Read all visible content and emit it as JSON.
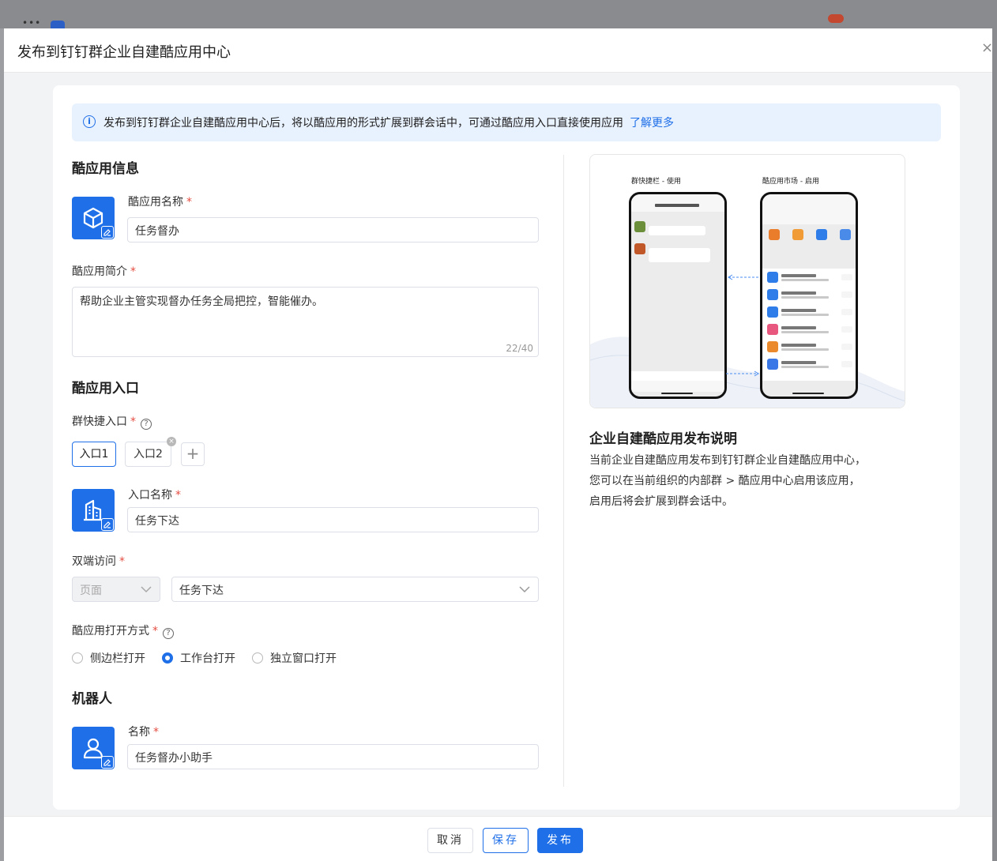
{
  "modal": {
    "title": "发布到钉钉群企业自建酷应用中心"
  },
  "notice": {
    "text": "发布到钉钉群企业自建酷应用中心后，将以酷应用的形式扩展到群会话中，可通过酷应用入口直接使用应用",
    "link": "了解更多"
  },
  "app_info": {
    "section_title": "酷应用信息",
    "name_label": "酷应用名称",
    "name_value": "任务督办",
    "intro_label": "酷应用简介",
    "intro_value": "帮助企业主管实现督办任务全局把控，智能催办。",
    "intro_counter": "22/40"
  },
  "entry": {
    "section_title": "酷应用入口",
    "quick_entry_label": "群快捷入口",
    "tabs": [
      "入口1",
      "入口2"
    ],
    "entry_name_label": "入口名称",
    "entry_name_value": "任务下达",
    "dual_access_label": "双端访问",
    "page_type_value": "页面",
    "page_value": "任务下达",
    "open_mode_label": "酷应用打开方式",
    "open_modes": [
      "侧边栏打开",
      "工作台打开",
      "独立窗口打开"
    ],
    "open_mode_selected": "工作台打开"
  },
  "robot": {
    "section_title": "机器人",
    "name_label": "名称",
    "name_value": "任务督办小助手"
  },
  "preview": {
    "left_caption": "群快捷栏 - 使用",
    "right_caption": "酷应用市场 - 启用"
  },
  "description": {
    "title": "企业自建酷应用发布说明",
    "lines": [
      "当前企业自建酷应用发布到钉钉群企业自建酷应用中心，",
      "您可以在当前组织的内部群 > 酷应用中心启用该应用，",
      "启用后将会扩展到群会话中。"
    ]
  },
  "footer": {
    "cancel": "取消",
    "save": "保存",
    "publish": "发布"
  },
  "colors": {
    "accent": "#1e6fe8",
    "required": "#e54d42",
    "notice_bg": "#e8f1fe"
  }
}
